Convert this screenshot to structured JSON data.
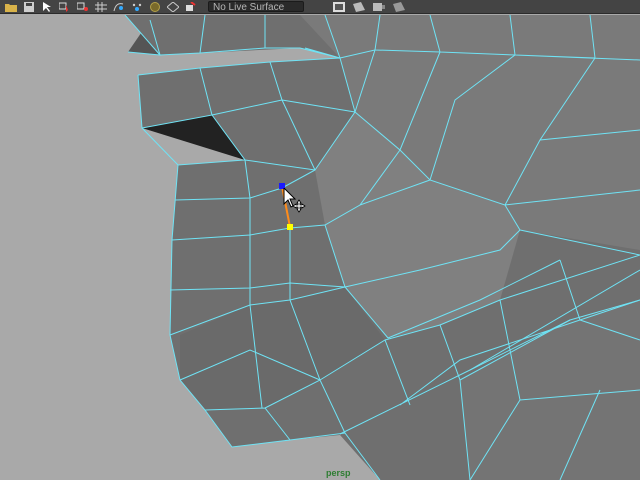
{
  "toolbar": {
    "icons": [
      "folder-open-icon",
      "save-icon",
      "select-tool-icon",
      "lasso-icon",
      "paint-select-icon",
      "snap-grid-icon",
      "snap-curve-icon",
      "snap-point-icon",
      "make-live-icon",
      "history-icon",
      "render-icon"
    ],
    "live_surface": "No Live Surface"
  },
  "viewport": {
    "camera": "persp",
    "colors": {
      "background": "#a9a9a9",
      "face": "#6f6f6f",
      "wire": "#6fe3f5",
      "selected_vertex": "#1a1aff",
      "target_vertex": "#ffff00",
      "edge_highlight": "#ff8c1a"
    }
  }
}
